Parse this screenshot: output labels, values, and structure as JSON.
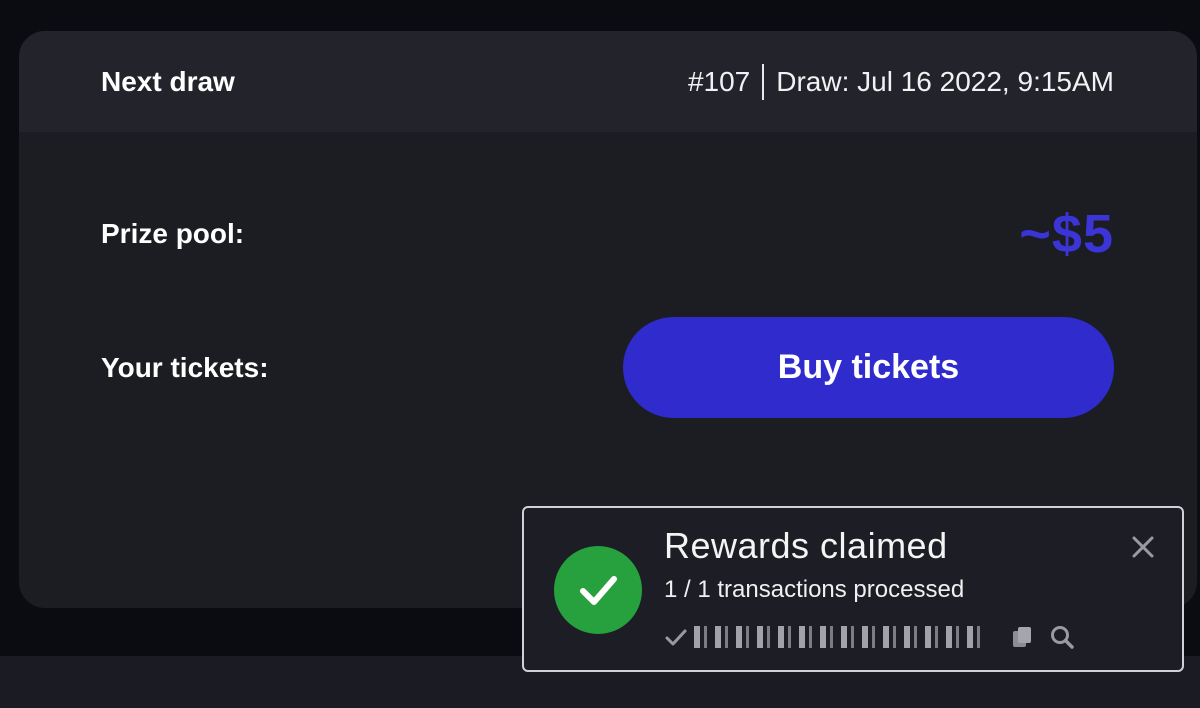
{
  "card": {
    "title": "Next draw",
    "round": "#107",
    "draw_date": "Draw: Jul 16 2022, 9:15AM",
    "prize_label": "Prize pool:",
    "prize_value": "~$5",
    "tickets_label": "Your tickets:",
    "buy_button": "Buy tickets"
  },
  "toast": {
    "title": "Rewards claimed",
    "subtitle": "1 / 1 transactions processed",
    "icons": [
      "check-circle-icon",
      "close-icon",
      "check-icon",
      "copy-icon",
      "search-icon"
    ]
  },
  "colors": {
    "accent": "#2f2bcc",
    "prize": "#3b34d6",
    "success": "#27a03e"
  }
}
